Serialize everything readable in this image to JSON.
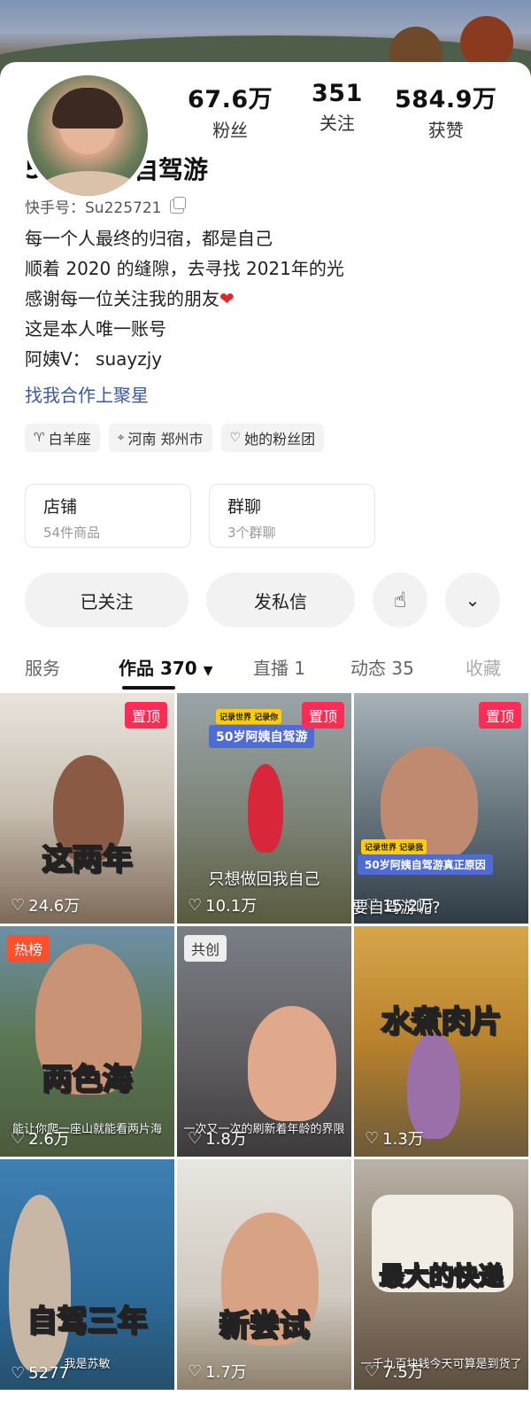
{
  "stats": {
    "fans_num": "67.6万",
    "fans_label": "粉丝",
    "following_num": "351",
    "following_label": "关注",
    "likes_num": "584.9万",
    "likes_label": "获赞"
  },
  "profile": {
    "name": "50岁阿姨自驾游",
    "uid": "快手号：Su225721",
    "bio": [
      "每一个人最终的归宿，都是自己",
      "顺着 2020 的缝隙，去寻找 2021年的光",
      "感谢每一位关注我的朋友",
      "这是本人唯一账号",
      "阿姨V：  suayzjy"
    ],
    "link": "找我合作上聚星"
  },
  "tags": [
    "白羊座",
    "河南 郑州市",
    "她的粉丝团"
  ],
  "cards": [
    {
      "title": "店铺",
      "sub": "54件商品"
    },
    {
      "title": "群聊",
      "sub": "3个群聊"
    }
  ],
  "buttons": {
    "follow": "已关注",
    "message": "发私信"
  },
  "tabs": [
    "服务",
    "作品 370",
    "直播 1",
    "动态 35",
    "收藏"
  ],
  "videos": [
    {
      "badge": "置顶",
      "caption": "这两年",
      "likes": "24.6万"
    },
    {
      "badge": "置顶",
      "caption": "只想做回我自己",
      "title": "50岁阿姨自驾游",
      "top_tag": "记录世界 记录你",
      "likes": "10.1万"
    },
    {
      "badge": "置顶",
      "caption": "要自驾游呢?",
      "title": "50岁阿姨自驾游真正原因",
      "top_tag": "记录世界 记录我",
      "likes": "15.2万"
    },
    {
      "badge": "热榜",
      "caption": "两色海",
      "sub": "能让你爬一座山就能看两片海",
      "likes": "2.6万"
    },
    {
      "badge": "共创",
      "caption": "",
      "sub": "一次又一次的刷新着年龄的界限",
      "likes": "1.8万"
    },
    {
      "badge": "",
      "caption": "水煮肉片",
      "likes": "1.3万"
    },
    {
      "badge": "",
      "caption": "自驾三年",
      "sub": "我是苏敏",
      "likes": "5277"
    },
    {
      "badge": "",
      "caption": "新尝试",
      "likes": "1.7万"
    },
    {
      "badge": "",
      "caption": "最大的快递",
      "sub": "一千九百块钱今天可算是到货了",
      "likes": "7.5万"
    }
  ]
}
